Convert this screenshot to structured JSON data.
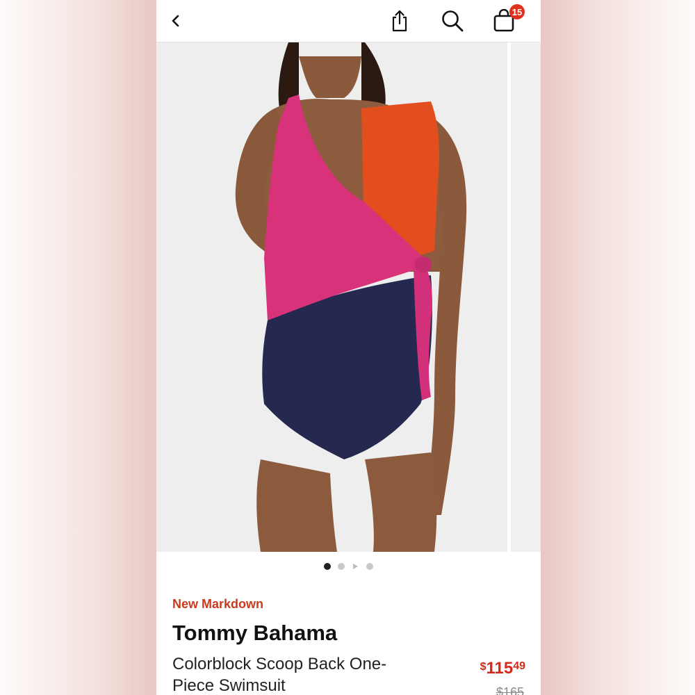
{
  "header": {
    "back_icon": "chevron-left-icon",
    "share_icon": "share-icon",
    "search_icon": "search-icon",
    "bag_icon": "shopping-bag-icon",
    "cart_count": "15"
  },
  "carousel": {
    "image_description_alt": "",
    "total_slides": 4,
    "active_index": 0
  },
  "product": {
    "promo_label": "New Markdown",
    "brand": "Tommy Bahama",
    "title": "Colorblock Scoop Back One-Piece Swimsuit",
    "price_currency": "$",
    "price_dollars": "115",
    "price_cents": "49",
    "original_price": "$165"
  },
  "colors": {
    "accent_red": "#d42a17",
    "promo_red": "#c93a1e",
    "badge_red": "#e0301e"
  }
}
